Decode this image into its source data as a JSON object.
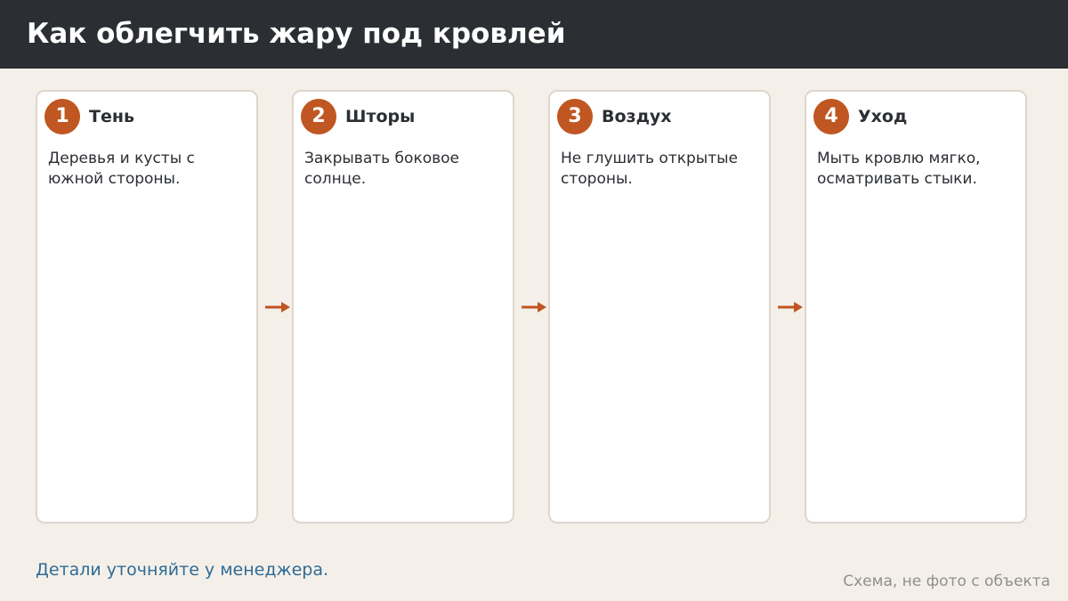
{
  "header": {
    "title": "Как облегчить жару под кровлей"
  },
  "steps": [
    {
      "number": "1",
      "title": "Тень",
      "text": "Деревья и кусты с южной стороны."
    },
    {
      "number": "2",
      "title": "Шторы",
      "text": "Закрывать боковое солнце."
    },
    {
      "number": "3",
      "title": "Воздух",
      "text": "Не глушить открытые стороны."
    },
    {
      "number": "4",
      "title": "Уход",
      "text": "Мыть кровлю мягко, осматривать стыки."
    }
  ],
  "connectors": [
    "arrow-right-icon",
    "arrow-right-icon",
    "arrow-right-icon"
  ],
  "footer": {
    "link_text": "Детали уточняйте у менеджера.",
    "note": "Схема, не фото с объекта"
  },
  "colors": {
    "background": "#f4f0e9",
    "header_bg": "#2b2e33",
    "accent": "#c05621",
    "card_border": "#ddd6cc",
    "link": "#2f6b96",
    "note": "#8f8f8f"
  }
}
